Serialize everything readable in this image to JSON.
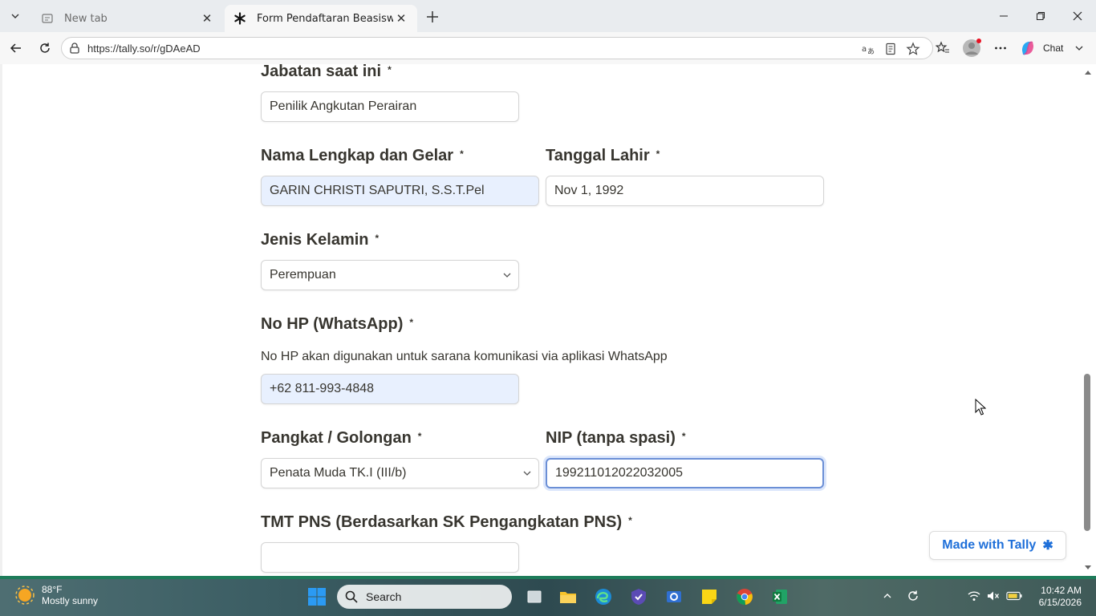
{
  "browser": {
    "tabs": [
      {
        "title": "New tab",
        "active": false
      },
      {
        "title": "Form Pendaftaran Beasiswa Progra",
        "active": true
      }
    ],
    "url": "https://tally.so/r/gDAeAD",
    "chat_label": "Chat"
  },
  "form": {
    "jabatan": {
      "label": "Jabatan saat ini",
      "value": "Penilik Angkutan Perairan"
    },
    "nama": {
      "label": "Nama Lengkap dan Gelar",
      "value": "GARIN CHRISTI SAPUTRI, S.S.T.Pel"
    },
    "tanggal": {
      "label": "Tanggal Lahir",
      "value": "Nov 1, 1992"
    },
    "kelamin": {
      "label": "Jenis Kelamin",
      "value": "Perempuan"
    },
    "hp": {
      "label": "No HP (WhatsApp)",
      "help": "No HP akan digunakan untuk sarana komunikasi via aplikasi WhatsApp",
      "value": "+62 811-993-4848"
    },
    "pangkat": {
      "label": "Pangkat / Golongan",
      "value": "Penata Muda TK.I (III/b)"
    },
    "nip": {
      "label": "NIP (tanpa spasi)",
      "value": "199211012022032005"
    },
    "tmt": {
      "label": "TMT PNS (Berdasarkan SK Pengangkatan PNS)",
      "value": ""
    },
    "required_mark": "*"
  },
  "badge": {
    "label": "Made with Tally",
    "icon": "tally-star-icon"
  },
  "taskbar": {
    "temperature": "88°F",
    "condition": "Mostly sunny",
    "search_placeholder": "Search",
    "time": "10:42 AM",
    "date": "6/15/2026"
  },
  "colors": {
    "accent": "#1e6fd9",
    "autofill": "#e8f0fe",
    "focus": "#6b8fd6"
  }
}
